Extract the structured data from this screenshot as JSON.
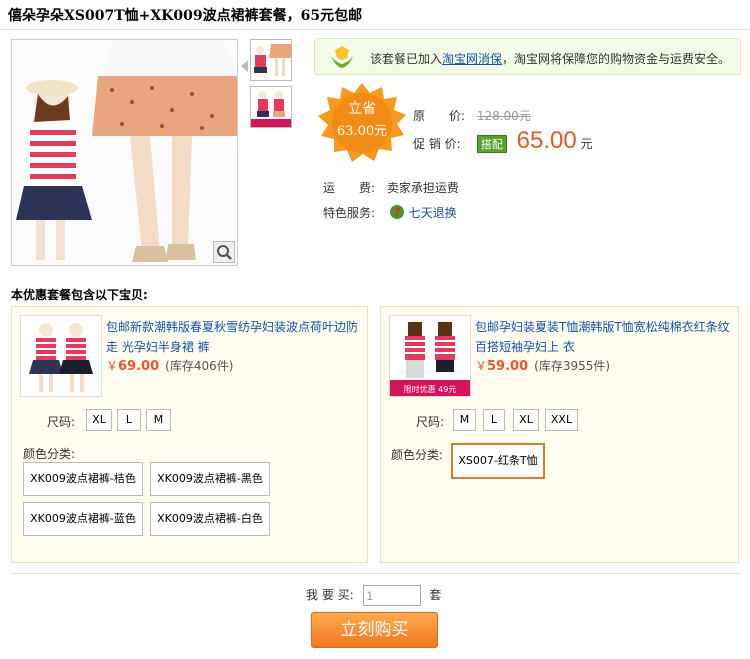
{
  "title": "僖朵孕朵XS007T恤+XK009波点裙裤套餐，65元包邮",
  "notice": {
    "prefix": "该套餐已加入",
    "link": "淘宝网消保",
    "suffix": "，淘宝网将保障您的购物资金与运费安全。"
  },
  "badge": {
    "line1": "立省",
    "line2": "63.00元"
  },
  "price": {
    "original_label": "原　　价:",
    "original_value": "128.00元",
    "promo_label": "促 销 价:",
    "promo_tag": "搭配",
    "promo_value": "65.00",
    "promo_unit": "元"
  },
  "shipping": {
    "label": "运　　费:",
    "value": "卖家承担运费"
  },
  "service": {
    "label": "特色服务:",
    "value": "七天退换"
  },
  "section_title": "本优惠套餐包含以下宝贝:",
  "items": [
    {
      "name": "包邮新款潮韩版春夏秋雪纺孕妇装波点荷叶边防走 光孕妇半身裙 裤",
      "yen": "￥",
      "price": "69.00",
      "stock": "(库存406件)",
      "size_label": "尺码:",
      "sizes": [
        "XL",
        "L",
        "M"
      ],
      "color_label": "颜色分类:",
      "colors": [
        "XK009波点裙裤-桔色",
        "XK009波点裙裤-黑色",
        "XK009波点裙裤-蓝色",
        "XK009波点裙裤-白色"
      ]
    },
    {
      "name": "包邮孕妇装夏装T恤潮韩版T恤宽松纯棉衣红条纹百搭短袖孕妇上 衣",
      "yen": "￥",
      "price": "59.00",
      "stock": "(库存3955件)",
      "size_label": "尺码:",
      "sizes": [
        "M",
        "L",
        "XL",
        "XXL"
      ],
      "color_label": "颜色分类:",
      "colors": [
        "XS007-红条T恤"
      ],
      "thumb_badge": "限时优惠 49元"
    }
  ],
  "quantity": {
    "label": "我 要 买:",
    "value": "1",
    "unit": "套"
  },
  "buy_button": "立刻购买",
  "colors": {
    "accent": "#e8562b",
    "link": "#1751a8",
    "button": "#f3761f"
  }
}
